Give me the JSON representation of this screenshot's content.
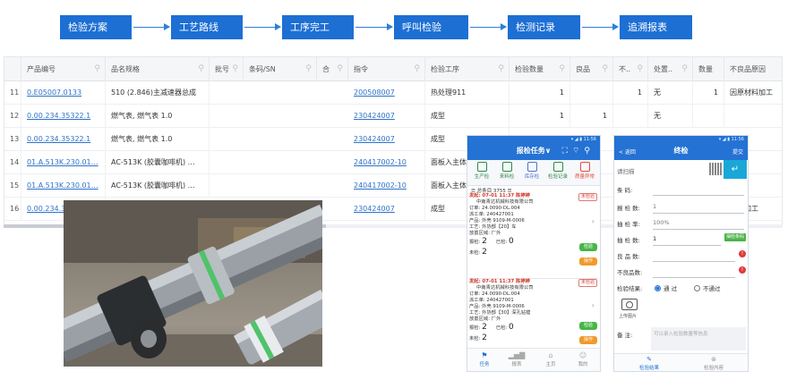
{
  "flow": {
    "steps": [
      "检验方案",
      "工艺路线",
      "工序完工",
      "呼叫检验",
      "检测记录",
      "追溯报表"
    ]
  },
  "table": {
    "columns": [
      "",
      "产品编号",
      "品名规格",
      "批号",
      "条码/SN",
      "合",
      "指令",
      "检验工序",
      "检验数量",
      "良品",
      "不..",
      "处置..",
      "数量",
      "不良品原因"
    ],
    "rows": [
      {
        "idx": "11",
        "code": "0.E05007.0133",
        "spec": "510 (2.846)主减速器总成",
        "order": "200508007",
        "process": "热处理911",
        "qty": "1",
        "good": "",
        "bad": "1",
        "dispose": "无",
        "num": "1",
        "reason": "因原材料加工"
      },
      {
        "idx": "12",
        "code": "0.00.234.35322.1",
        "spec": "燃气表, 燃气表 1.0",
        "order": "230424007",
        "process": "成型",
        "qty": "1",
        "good": "1",
        "bad": "",
        "dispose": "无",
        "num": "",
        "reason": ""
      },
      {
        "idx": "13",
        "code": "0.00.234.35322.1",
        "spec": "燃气表, 燃气表 1.0",
        "order": "230424007",
        "process": "成型",
        "qty": "",
        "good": "",
        "bad": "",
        "dispose": "",
        "num": "",
        "reason": ""
      },
      {
        "idx": "14",
        "code": "01.A.513K.230.01…",
        "spec": "AC-513K (胶囊咖啡机) …",
        "order": "240417002-10",
        "process": "面板入主体",
        "qty": "",
        "good": "",
        "bad": "",
        "dispose": "",
        "num": "",
        "reason": ""
      },
      {
        "idx": "15",
        "code": "01.A.513K.230.01…",
        "spec": "AC-513K (胶囊咖啡机) …",
        "order": "240417002-10",
        "process": "面板入主体",
        "qty": "",
        "good": "",
        "bad": "",
        "dispose": "",
        "num": "",
        "reason": ""
      },
      {
        "idx": "16",
        "code": "0.00.234.3",
        "spec": "",
        "order": "230424007",
        "process": "成型",
        "qty": "",
        "good": "",
        "bad": "",
        "dispose": "",
        "num": "",
        "reason": "材料加工"
      }
    ]
  },
  "phone1": {
    "title": "报检任务∨",
    "tabs": [
      "生产检",
      "来料检",
      "库存检",
      "检验记录",
      "质量异常"
    ],
    "total": "总条目 3755",
    "tasks": [
      {
        "send": "发起: 07-01 11:37  陈婷婷",
        "status": "未检验",
        "company": "中南青达机械科技有限公司",
        "order": "订单: 24.0090-DL.004",
        "dispatch": "派工单: 240427001",
        "product": "产品: 外壳 9109-M-0006",
        "craft": "工艺: 外协部【20】车",
        "area": "放置区域: 厂外",
        "report_label": "报检:",
        "report_val": "2",
        "checked_label": "已检:",
        "checked_val": "0",
        "unchecked_label": "未检:",
        "unchecked_val": "2",
        "btn_inspect": "检验",
        "btn_operate": "操作"
      },
      {
        "send": "发起: 07-01 11:37  陈婷婷",
        "status": "未检验",
        "company": "中南青达机械科技有限公司",
        "order": "订单: 24.0090-DL.004",
        "dispatch": "派工单: 240427001",
        "product": "产品: 外壳 9109-M-0006",
        "craft": "工艺: 外协部【30】深孔钻镗",
        "area": "放置区域: 厂外",
        "report_label": "报检:",
        "report_val": "2",
        "checked_label": "已检:",
        "checked_val": "0",
        "unchecked_label": "未检:",
        "unchecked_val": "2",
        "btn_inspect": "检验",
        "btn_operate": "操作"
      }
    ],
    "footer": [
      "任务",
      "报表",
      "主页",
      "我的"
    ]
  },
  "phone2": {
    "back": "< 返回",
    "title": "终检",
    "submit": "提交",
    "scan_placeholder": "请扫描",
    "fields": [
      {
        "label": "条    码:",
        "value": ""
      },
      {
        "label": "报 检 数:",
        "value": "1"
      },
      {
        "label": "抽 检 率:",
        "value": "100%"
      },
      {
        "label": "抽 检 数:",
        "value": "1"
      },
      {
        "label": "良 品 数:",
        "value": ""
      },
      {
        "label": "不良品数:",
        "value": ""
      }
    ],
    "sample_btn": "抽检条码",
    "result_label": "检验结果:",
    "pass": "通  过",
    "fail": "不通过",
    "upload": "上传图片",
    "note_label": "备    注:",
    "note_placeholder": "可以录入检验数量等信息",
    "footer": [
      "检验结果",
      "检验内容"
    ]
  }
}
